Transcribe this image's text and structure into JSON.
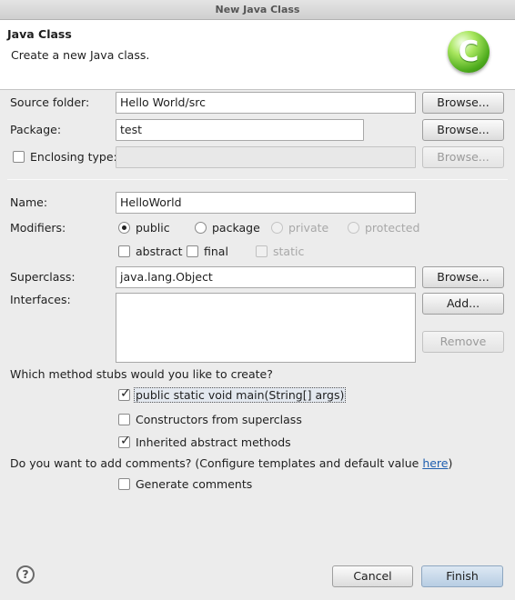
{
  "window": {
    "title": "New Java Class"
  },
  "banner": {
    "title": "Java Class",
    "description": "Create a new Java class.",
    "logo_letter": "C"
  },
  "source_folder": {
    "label": "Source folder:",
    "value": "Hello World/src",
    "browse": "Browse..."
  },
  "package": {
    "label": "Package:",
    "value": "test",
    "browse": "Browse..."
  },
  "enclosing": {
    "label": "Enclosing type:",
    "value": "",
    "browse": "Browse...",
    "checked": false
  },
  "name": {
    "label": "Name:",
    "value": "HelloWorld"
  },
  "modifiers": {
    "label": "Modifiers:",
    "public": "public",
    "package": "package",
    "private": "private",
    "protected": "protected",
    "abstract": "abstract",
    "final": "final",
    "static": "static",
    "selected": "public"
  },
  "superclass": {
    "label": "Superclass:",
    "value": "java.lang.Object",
    "browse": "Browse..."
  },
  "interfaces": {
    "label": "Interfaces:",
    "add": "Add...",
    "remove": "Remove"
  },
  "stubs": {
    "question": "Which method stubs would you like to create?",
    "main": "public static void main(String[] args)",
    "constructors": "Constructors from superclass",
    "inherited": "Inherited abstract methods",
    "main_checked": true,
    "constructors_checked": false,
    "inherited_checked": true
  },
  "comments": {
    "question": "Do you want to add comments? (Configure templates and default value ",
    "link": "here",
    "question_end": ")",
    "generate": "Generate comments",
    "generate_checked": false
  },
  "footer": {
    "help": "?",
    "cancel": "Cancel",
    "finish": "Finish"
  }
}
